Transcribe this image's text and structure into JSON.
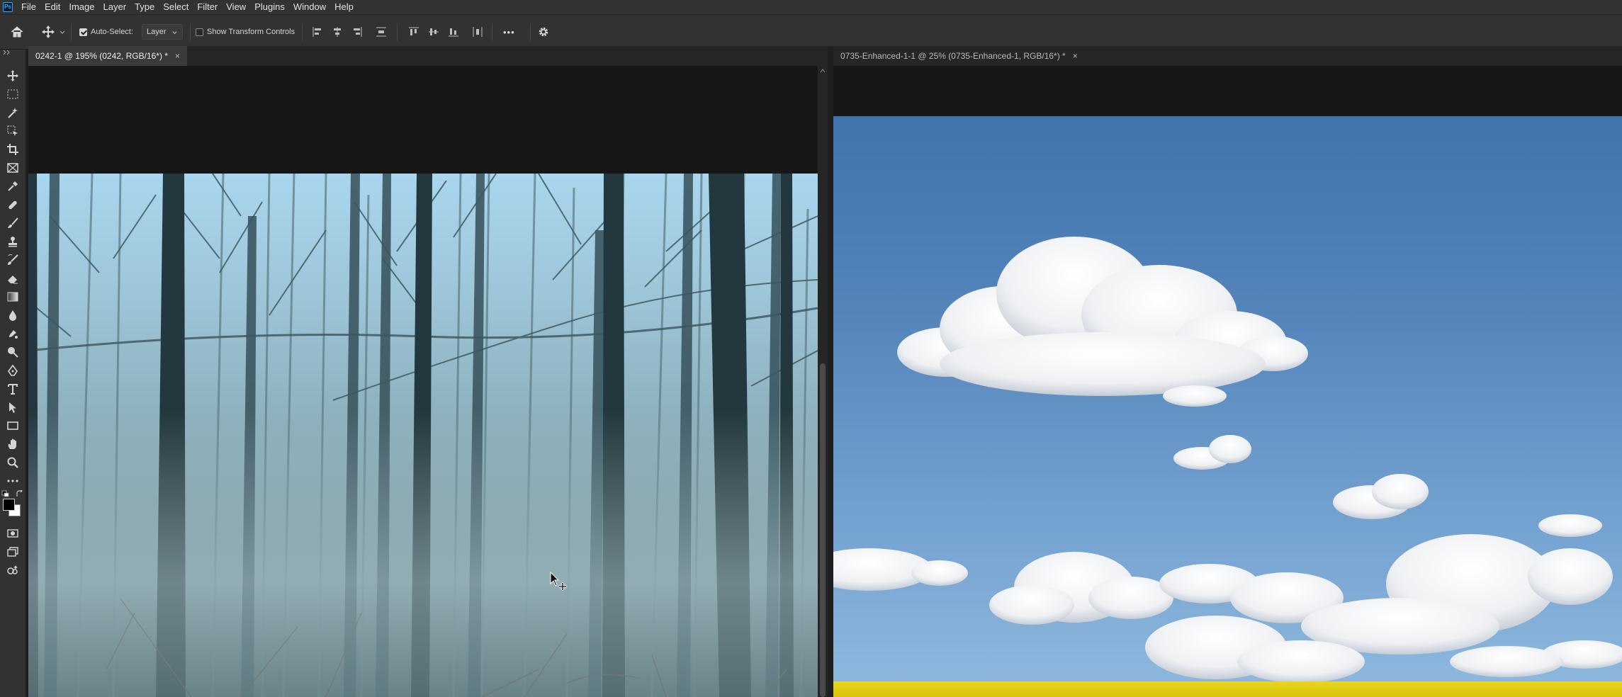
{
  "app": {
    "logo_text": "Ps"
  },
  "menu": [
    "File",
    "Edit",
    "Image",
    "Layer",
    "Type",
    "Select",
    "Filter",
    "View",
    "Plugins",
    "Window",
    "Help"
  ],
  "options_bar": {
    "auto_select_label": "Auto-Select:",
    "auto_select_checked": true,
    "auto_select_target": "Layer",
    "show_transform_label": "Show Transform Controls",
    "show_transform_checked": false,
    "more_label": "•••"
  },
  "tools": [
    "move-tool",
    "marquee-tool",
    "lasso-tool",
    "object-selection-tool",
    "crop-tool",
    "frame-tool",
    "eyedropper-tool",
    "spot-healing-tool",
    "brush-tool",
    "clone-stamp-tool",
    "history-brush-tool",
    "eraser-tool",
    "gradient-tool",
    "blur-tool",
    "dodge-tool",
    "smudge-tool",
    "pen-tool",
    "type-tool",
    "path-selection-tool",
    "rectangle-tool",
    "hand-tool",
    "zoom-tool",
    "edit-toolbar",
    "quick-mask",
    "screen-mode",
    "generative-fill"
  ],
  "colors": {
    "foreground": "#000000",
    "background": "#ffffff",
    "accent": "#31a8ff"
  },
  "documents": [
    {
      "tab_label": "0242-1 @ 195% (0242, RGB/16*) *",
      "close": "×",
      "active": true
    },
    {
      "tab_label": "0735-Enhanced-1-1 @ 25% (0735-Enhanced-1, RGB/16*) *",
      "close": "×",
      "active": false
    }
  ]
}
